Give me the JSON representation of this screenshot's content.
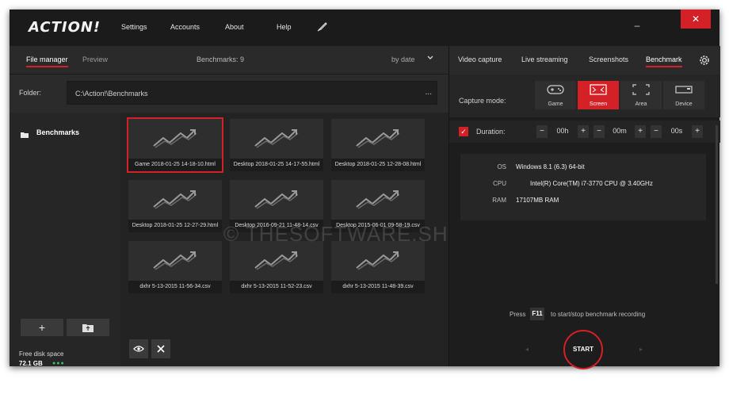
{
  "app": {
    "logo_text": "ACTION!",
    "nav": [
      "Settings",
      "Accounts",
      "About",
      "Help"
    ],
    "close_symbol": "✕",
    "minimize_symbol": "–"
  },
  "left": {
    "tabs": [
      "File manager",
      "Preview"
    ],
    "benchmarks_count_label": "Benchmarks: 9",
    "sort_label": "by date",
    "folder_label": "Folder:",
    "folder_path": "C:\\Action!\\Benchmarks",
    "folder_more": "...",
    "sidebar_item": "Benchmarks",
    "add_symbol": "+",
    "disk_label": "Free disk space",
    "disk_value": "72.1 GB",
    "disk_dots": "●●●",
    "thumbnails": [
      {
        "caption": "Game 2018-01-25 14-18-10.html",
        "selected": true
      },
      {
        "caption": "Desktop 2018-01-25 14-17-55.html",
        "selected": false
      },
      {
        "caption": "Desktop 2018-01-25 12-28-08.html",
        "selected": false
      },
      {
        "caption": "Desktop 2018-01-25 12-27-29.html",
        "selected": false
      },
      {
        "caption": "Desktop 2016-09-21 11-48-14.csv",
        "selected": false
      },
      {
        "caption": "Desktop 2015-06-01 09-58-19.csv",
        "selected": false
      },
      {
        "caption": "dxhr 5-13-2015 11-56-34.csv",
        "selected": false
      },
      {
        "caption": "dxhr 5-13-2015 11-52-23.csv",
        "selected": false
      },
      {
        "caption": "dxhr 5-13-2015 11-48-39.csv",
        "selected": false
      }
    ],
    "watermark": "© THESOFTWARE.SHOP"
  },
  "right": {
    "tabs": [
      "Video capture",
      "Live streaming",
      "Screenshots",
      "Benchmark"
    ],
    "capture_mode_label": "Capture mode:",
    "modes": [
      "Game",
      "Screen",
      "Area",
      "Device"
    ],
    "active_mode": "Screen",
    "duration_label": "Duration:",
    "duration": {
      "hours": "00h",
      "minutes": "00m",
      "seconds": "00s"
    },
    "checkmark": "✓",
    "sysinfo": [
      {
        "key": "OS",
        "value": "Windows 8.1 (6.3) 64-bit"
      },
      {
        "key": "CPU",
        "value": "Intel(R) Core(TM) i7-3770 CPU @ 3.40GHz"
      },
      {
        "key": "RAM",
        "value": "17107MB RAM"
      }
    ],
    "hint_press": "Press",
    "hint_key": "F11",
    "hint_rest": "to start/stop benchmark recording",
    "start_label": "START",
    "minus": "−",
    "plus": "+"
  },
  "colors": {
    "accent": "#d42027",
    "background": "#1f1f1f",
    "disk_ok": "#39c06a"
  }
}
